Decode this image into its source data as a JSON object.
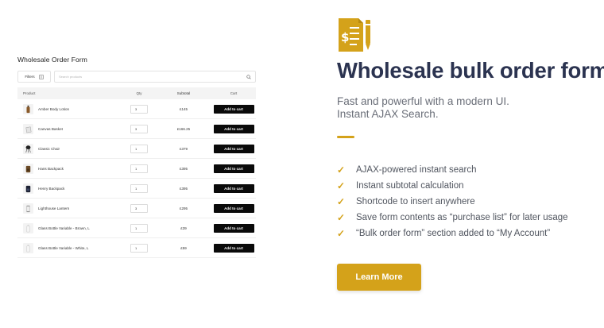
{
  "form": {
    "title": "Wholesale Order Form",
    "filters_label": "Filters",
    "search_placeholder": "Search products",
    "columns": {
      "product": "Product",
      "qty": "Qty",
      "subtotal": "Subtotal",
      "cart": "Cart"
    },
    "rows": [
      {
        "name": "Amber Body Lotion",
        "qty": "3",
        "subtotal": "£145",
        "cart": "Add to cart",
        "thumb": "bottle-icon"
      },
      {
        "name": "Canvas Basket",
        "qty": "3",
        "subtotal": "£166.25",
        "cart": "Add to cart",
        "thumb": "basket-icon"
      },
      {
        "name": "Classic Chair",
        "qty": "1",
        "subtotal": "£379",
        "cart": "Add to cart",
        "thumb": "chair-icon"
      },
      {
        "name": "Hans Backpack",
        "qty": "1",
        "subtotal": "£395",
        "cart": "Add to cart",
        "thumb": "backpack-icon"
      },
      {
        "name": "Henry Backpack",
        "qty": "1",
        "subtotal": "£395",
        "cart": "Add to cart",
        "thumb": "backpack-icon"
      },
      {
        "name": "Lighthouse Lantern",
        "qty": "3",
        "subtotal": "£295",
        "cart": "Add to cart",
        "thumb": "lantern-icon"
      },
      {
        "name": "Glass Bottle Variable - Brown, L",
        "qty": "1",
        "subtotal": "£39",
        "cart": "Add to cart",
        "thumb": "bottle-icon"
      },
      {
        "name": "Glass Bottle Variable - White, L",
        "qty": "1",
        "subtotal": "£59",
        "cart": "Add to cart",
        "thumb": "bottle-icon"
      }
    ]
  },
  "promo": {
    "icon": "order-form-document-icon",
    "headline": "Wholesale bulk order form.",
    "subline_1": "Fast and powerful with a modern UI.",
    "subline_2": "Instant AJAX Search.",
    "features": [
      "AJAX-powered instant search",
      "Instant subtotal calculation",
      "Shortcode to insert anywhere",
      "Save form contents as “purchase list” for later usage",
      "“Bulk order form” section added to “My Account”"
    ],
    "check_glyph": "✓",
    "cta_label": "Learn More"
  },
  "colors": {
    "accent": "#d4a21a",
    "heading": "#2b3350",
    "body_text": "#6a6e78",
    "button_dark": "#0a0a0a"
  }
}
